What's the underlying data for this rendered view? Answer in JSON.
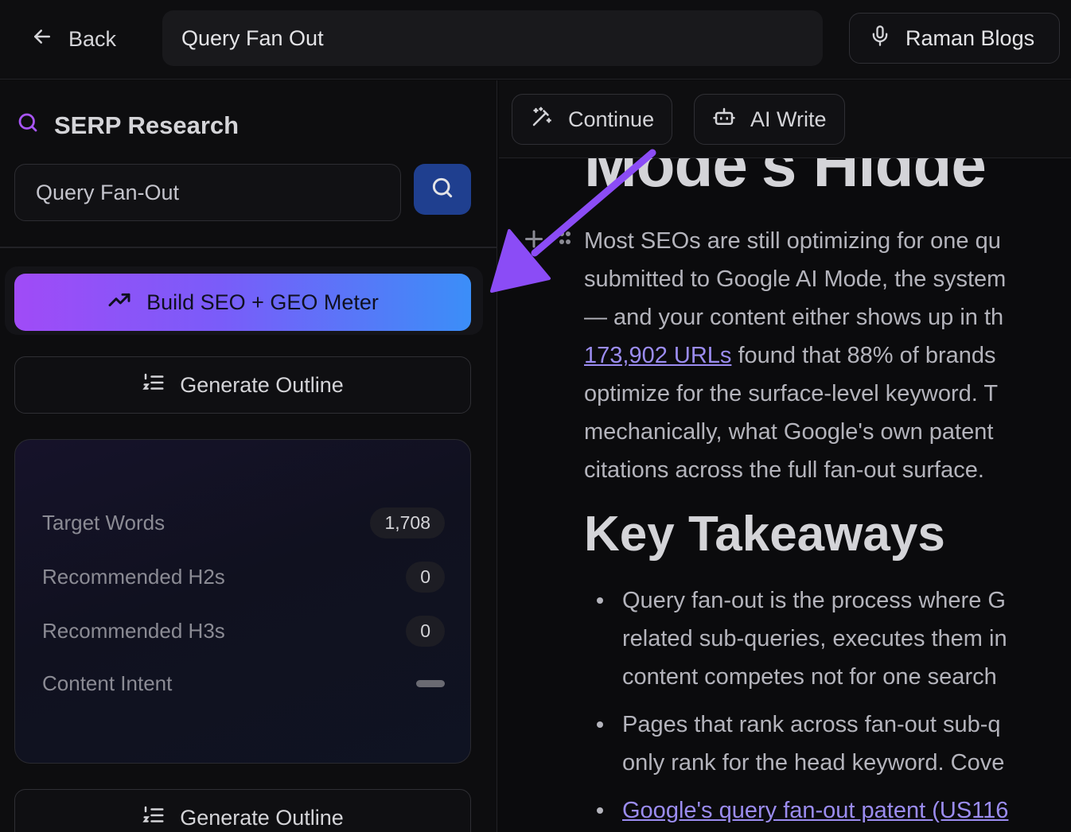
{
  "header": {
    "back_label": "Back",
    "document_title": "Query Fan Out",
    "workspace_name": "Raman Blogs"
  },
  "sidebar": {
    "section_title": "SERP Research",
    "keyword_input_value": "Query Fan-Out",
    "build_button_label": "Build SEO + GEO Meter",
    "generate_outline_label": "Generate Outline",
    "generate_outline_label_2": "Generate Outline",
    "stats": [
      {
        "label": "Target Words",
        "value": "1,708"
      },
      {
        "label": "Recommended H2s",
        "value": "0"
      },
      {
        "label": "Recommended H3s",
        "value": "0"
      },
      {
        "label": "Content Intent",
        "value": ""
      }
    ]
  },
  "editor": {
    "toolbar": {
      "continue_label": "Continue",
      "ai_write_label": "AI Write"
    },
    "heading_partial": "Mode's Hidde",
    "paragraph": {
      "line1": "Most SEOs are still optimizing for one qu",
      "line2": "submitted to Google AI Mode, the system",
      "line3": "— and your content either shows up in th",
      "line4_link": "173,902 URLs",
      "line4_rest": " found that 88% of brands",
      "line5": "optimize for the surface-level keyword. T",
      "line6": "mechanically, what Google's own patent",
      "line7": "citations across the full fan-out surface."
    },
    "section_heading": "Key Takeaways",
    "bullets": [
      {
        "lines": [
          "Query fan-out is the process where G",
          "related sub-queries, executes them in",
          "content competes not for one search"
        ]
      },
      {
        "lines": [
          "Pages that rank across fan-out sub-q",
          "only rank for the head keyword. Cove"
        ]
      },
      {
        "link": "Google's query fan-out patent (US116"
      }
    ]
  },
  "colors": {
    "accent_purple": "#a04bf7",
    "accent_blue": "#3b8ef8",
    "annotation_arrow": "#8b4cf6",
    "link": "#9b8cf0"
  }
}
